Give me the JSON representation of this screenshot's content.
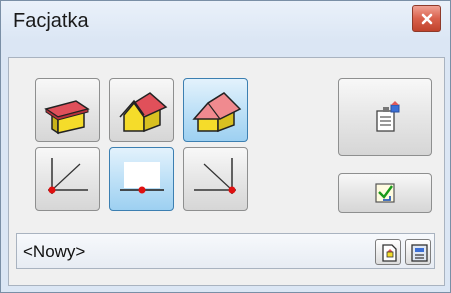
{
  "window": {
    "title": "Facjatka",
    "close_icon": "close-x-icon"
  },
  "roof_types": [
    {
      "icon": "flat-roof-house-icon",
      "pressed": false
    },
    {
      "icon": "gable-roof-house-icon",
      "pressed": false
    },
    {
      "icon": "hip-roof-house-icon",
      "pressed": true
    }
  ],
  "anchor_points": [
    {
      "icon": "anchor-left-corner-icon",
      "pressed": false
    },
    {
      "icon": "anchor-bottom-center-icon",
      "pressed": true
    },
    {
      "icon": "anchor-right-corner-icon",
      "pressed": false
    }
  ],
  "side_buttons": {
    "properties_icon": "properties-icon",
    "apply_icon": "apply-checkmark-icon"
  },
  "style_selector": {
    "value": "<Nowy>",
    "open_icon": "open-style-icon",
    "save_icon": "save-style-icon"
  },
  "colors": {
    "roof_red": "#e0505a",
    "wall_yellow": "#f5dc2a",
    "pressed_blue": "#9dd0f1",
    "anchor_dot": "#e01010"
  }
}
